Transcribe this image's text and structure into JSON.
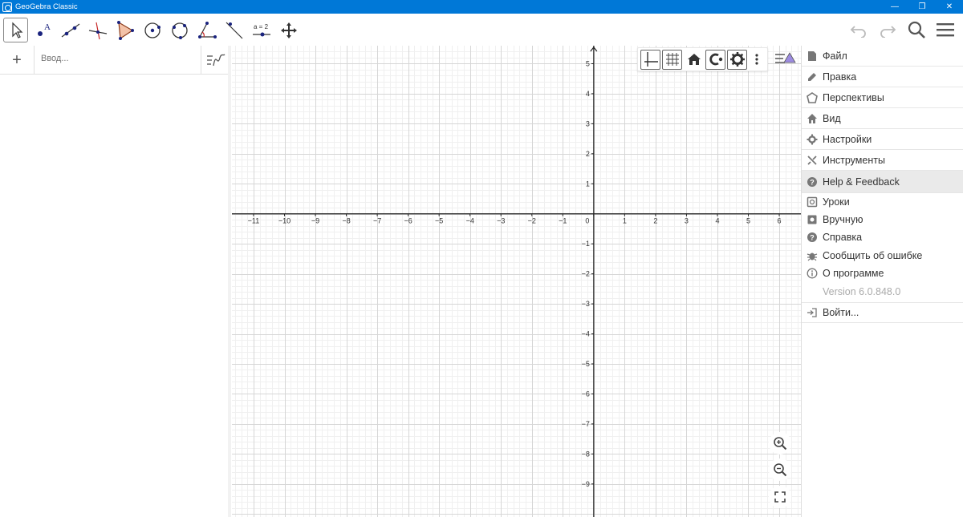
{
  "window": {
    "title": "GeoGebra Classic",
    "minimize_glyph": "—",
    "maximize_glyph": "❐",
    "close_glyph": "✕"
  },
  "toolbar": {
    "tools": [
      {
        "name": "move-tool",
        "selected": true
      },
      {
        "name": "point-tool",
        "selected": false
      },
      {
        "name": "line-tool",
        "selected": false
      },
      {
        "name": "perpendicular-line-tool",
        "selected": false
      },
      {
        "name": "polygon-tool",
        "selected": false
      },
      {
        "name": "circle-tool",
        "selected": false
      },
      {
        "name": "circle-through-three-points-tool",
        "selected": false
      },
      {
        "name": "angle-tool",
        "selected": false
      },
      {
        "name": "reflect-tool",
        "selected": false
      },
      {
        "name": "slider-tool",
        "selected": false
      },
      {
        "name": "move-graphics-view-tool",
        "selected": false
      }
    ],
    "slider_label": "a = 2",
    "right": [
      "undo-icon",
      "redo-icon",
      "search-icon",
      "hamburger-menu-icon"
    ]
  },
  "algebra": {
    "add_glyph": "+",
    "input_placeholder": "Ввод..."
  },
  "graphics": {
    "x_ticks": [
      "−11",
      "−10",
      "−9",
      "−8",
      "−7",
      "−6",
      "−5",
      "−4",
      "−3",
      "−2",
      "−1",
      "0",
      "1",
      "2",
      "3",
      "4",
      "5",
      "6"
    ],
    "y_ticks_pos": [
      "1",
      "2",
      "3",
      "4",
      "5"
    ],
    "y_ticks_neg": [
      "−1",
      "−2",
      "−3",
      "−4",
      "−5",
      "−6",
      "−7",
      "−8",
      "−9"
    ],
    "x_range": [
      -11.7,
      6.7
    ],
    "y_range": [
      -10.1,
      5.6
    ],
    "grid": true,
    "style_bar": [
      "axes-icon",
      "grid-icon",
      "home-icon",
      "point-capturing-icon",
      "settings-icon",
      "more-icon"
    ],
    "zoom_controls": [
      "zoom-in-icon",
      "zoom-out-icon",
      "fullscreen-icon"
    ]
  },
  "menu": {
    "main": [
      {
        "label": "Файл",
        "icon": "file-icon"
      },
      {
        "label": "Правка",
        "icon": "pencil-icon"
      },
      {
        "label": "Перспективы",
        "icon": "perspectives-icon"
      },
      {
        "label": "Вид",
        "icon": "home-icon"
      },
      {
        "label": "Настройки",
        "icon": "gear-icon"
      },
      {
        "label": "Инструменты",
        "icon": "tools-icon"
      },
      {
        "label": "Help & Feedback",
        "icon": "help-icon"
      }
    ],
    "help": [
      {
        "label": "Уроки",
        "icon": "tutorials-icon"
      },
      {
        "label": "Вручную",
        "icon": "manual-icon"
      },
      {
        "label": "Справка",
        "icon": "help-circle-icon"
      },
      {
        "label": "Сообщить об ошибке",
        "icon": "bug-icon"
      },
      {
        "label": "О программе",
        "icon": "info-icon"
      }
    ],
    "version": "Version 6.0.848.0",
    "signin": {
      "label": "Войти...",
      "icon": "signin-icon"
    }
  }
}
